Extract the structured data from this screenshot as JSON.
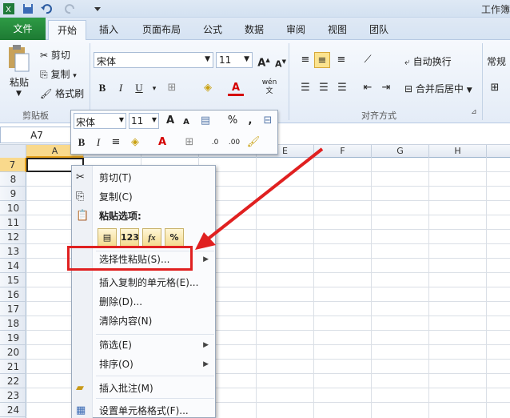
{
  "app": {
    "title": "工作簿"
  },
  "tabs": [
    "文件",
    "开始",
    "插入",
    "页面布局",
    "公式",
    "数据",
    "审阅",
    "视图",
    "团队"
  ],
  "ribbon": {
    "clipboard": {
      "paste": "粘贴",
      "cut": "剪切",
      "copy": "复制",
      "format_painter": "格式刷",
      "group": "剪贴板"
    },
    "font": {
      "name": "宋体",
      "size": "11",
      "bold": "B",
      "italic": "I",
      "underline": "U",
      "font_color": "A",
      "phonetic": "wén"
    },
    "alignment": {
      "wrap": "自动换行",
      "merge": "合并后居中",
      "group": "对齐方式"
    },
    "number": {
      "format": "常规"
    }
  },
  "namebox": {
    "value": "A7"
  },
  "columns": [
    "A",
    "B",
    "C",
    "D",
    "E",
    "F",
    "G",
    "H"
  ],
  "rows": [
    "7",
    "8",
    "9",
    "10",
    "11",
    "12",
    "13",
    "14",
    "15",
    "16",
    "17",
    "18",
    "19",
    "20",
    "21",
    "22",
    "23",
    "24"
  ],
  "minibar": {
    "font": "宋体",
    "size": "11",
    "percent": "%",
    "comma": ",",
    "bold": "B",
    "italic": "I"
  },
  "context_menu": {
    "cut": "剪切(T)",
    "copy": "复制(C)",
    "paste_options": "粘贴选项:",
    "paste_buttons": [
      "",
      "123",
      "fx",
      "%"
    ],
    "paste_special": "选择性粘贴(S)...",
    "insert_copied": "插入复制的单元格(E)...",
    "delete": "删除(D)...",
    "clear": "清除内容(N)",
    "filter": "筛选(E)",
    "sort": "排序(O)",
    "insert_comment": "插入批注(M)",
    "format_cells": "设置单元格格式(F)..."
  },
  "colors": {
    "file_tab": "#2e9b45",
    "highlight": "#e02020",
    "ribbon": "#e4ecf7"
  }
}
